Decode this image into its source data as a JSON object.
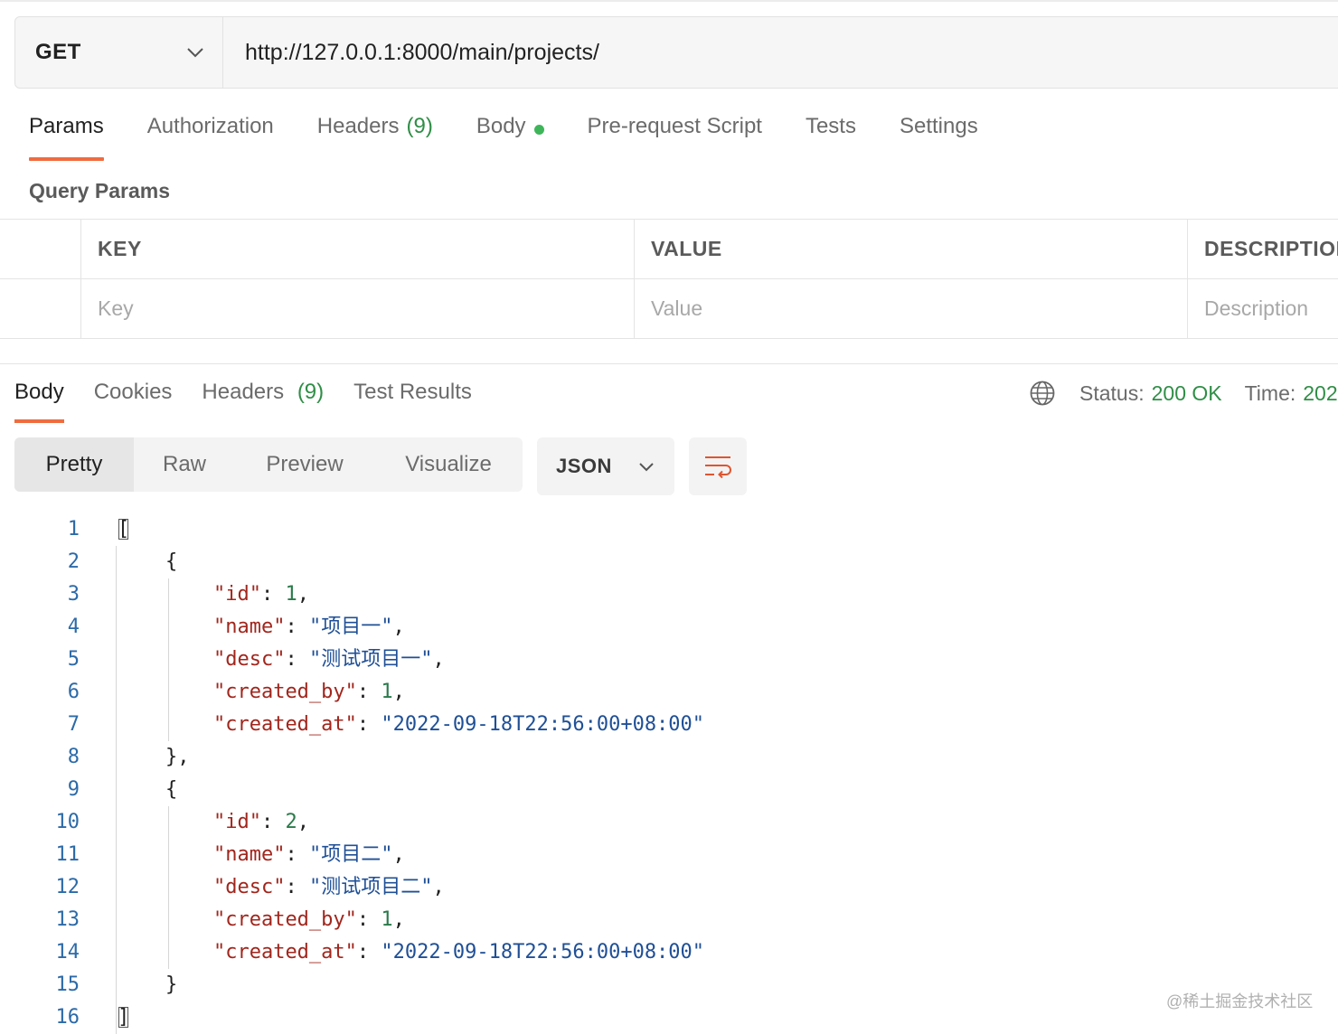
{
  "request": {
    "method": "GET",
    "url": "http://127.0.0.1:8000/main/projects/"
  },
  "request_tabs": [
    {
      "label": "Params",
      "count": ""
    },
    {
      "label": "Authorization",
      "count": ""
    },
    {
      "label": "Headers",
      "count": "(9)"
    },
    {
      "label": "Body",
      "count": ""
    },
    {
      "label": "Pre-request Script",
      "count": ""
    },
    {
      "label": "Tests",
      "count": ""
    },
    {
      "label": "Settings",
      "count": ""
    }
  ],
  "query_params": {
    "title": "Query Params",
    "headers": [
      "KEY",
      "VALUE",
      "DESCRIPTION"
    ],
    "placeholders": [
      "Key",
      "Value",
      "Description"
    ]
  },
  "response_tabs": [
    {
      "label": "Body",
      "count": ""
    },
    {
      "label": "Cookies",
      "count": ""
    },
    {
      "label": "Headers",
      "count": "(9)"
    },
    {
      "label": "Test Results",
      "count": ""
    }
  ],
  "status": {
    "status_label": "Status:",
    "status_value": "200 OK",
    "time_label": "Time:",
    "time_value": "202"
  },
  "format_tabs": [
    "Pretty",
    "Raw",
    "Preview",
    "Visualize"
  ],
  "format_select": "JSON",
  "code_lines": [
    [
      {
        "t": "p",
        "v": "["
      }
    ],
    [
      {
        "t": "p",
        "v": "    {"
      }
    ],
    [
      {
        "t": "p",
        "v": "        "
      },
      {
        "t": "k",
        "v": "\"id\""
      },
      {
        "t": "p",
        "v": ": "
      },
      {
        "t": "n",
        "v": "1"
      },
      {
        "t": "p",
        "v": ","
      }
    ],
    [
      {
        "t": "p",
        "v": "        "
      },
      {
        "t": "k",
        "v": "\"name\""
      },
      {
        "t": "p",
        "v": ": "
      },
      {
        "t": "s",
        "v": "\"项目一\""
      },
      {
        "t": "p",
        "v": ","
      }
    ],
    [
      {
        "t": "p",
        "v": "        "
      },
      {
        "t": "k",
        "v": "\"desc\""
      },
      {
        "t": "p",
        "v": ": "
      },
      {
        "t": "s",
        "v": "\"测试项目一\""
      },
      {
        "t": "p",
        "v": ","
      }
    ],
    [
      {
        "t": "p",
        "v": "        "
      },
      {
        "t": "k",
        "v": "\"created_by\""
      },
      {
        "t": "p",
        "v": ": "
      },
      {
        "t": "n",
        "v": "1"
      },
      {
        "t": "p",
        "v": ","
      }
    ],
    [
      {
        "t": "p",
        "v": "        "
      },
      {
        "t": "k",
        "v": "\"created_at\""
      },
      {
        "t": "p",
        "v": ": "
      },
      {
        "t": "s",
        "v": "\"2022-09-18T22:56:00+08:00\""
      }
    ],
    [
      {
        "t": "p",
        "v": "    },"
      }
    ],
    [
      {
        "t": "p",
        "v": "    {"
      }
    ],
    [
      {
        "t": "p",
        "v": "        "
      },
      {
        "t": "k",
        "v": "\"id\""
      },
      {
        "t": "p",
        "v": ": "
      },
      {
        "t": "n",
        "v": "2"
      },
      {
        "t": "p",
        "v": ","
      }
    ],
    [
      {
        "t": "p",
        "v": "        "
      },
      {
        "t": "k",
        "v": "\"name\""
      },
      {
        "t": "p",
        "v": ": "
      },
      {
        "t": "s",
        "v": "\"项目二\""
      },
      {
        "t": "p",
        "v": ","
      }
    ],
    [
      {
        "t": "p",
        "v": "        "
      },
      {
        "t": "k",
        "v": "\"desc\""
      },
      {
        "t": "p",
        "v": ": "
      },
      {
        "t": "s",
        "v": "\"测试项目二\""
      },
      {
        "t": "p",
        "v": ","
      }
    ],
    [
      {
        "t": "p",
        "v": "        "
      },
      {
        "t": "k",
        "v": "\"created_by\""
      },
      {
        "t": "p",
        "v": ": "
      },
      {
        "t": "n",
        "v": "1"
      },
      {
        "t": "p",
        "v": ","
      }
    ],
    [
      {
        "t": "p",
        "v": "        "
      },
      {
        "t": "k",
        "v": "\"created_at\""
      },
      {
        "t": "p",
        "v": ": "
      },
      {
        "t": "s",
        "v": "\"2022-09-18T22:56:00+08:00\""
      }
    ],
    [
      {
        "t": "p",
        "v": "    }"
      }
    ],
    [
      {
        "t": "p",
        "v": "]"
      }
    ]
  ],
  "watermark": "@稀土掘金技术社区",
  "colors": {
    "accent": "#ef6c3f",
    "success": "#2f8e46",
    "json_key": "#a1261d",
    "json_string": "#1f4f96",
    "json_number": "#2a7a4a",
    "line_number": "#2c6aa8"
  },
  "icons": {
    "method_dropdown": "chevron-down-icon",
    "globe": "globe-icon",
    "format_dropdown": "chevron-down-icon",
    "wrap": "wrap-lines-icon"
  }
}
